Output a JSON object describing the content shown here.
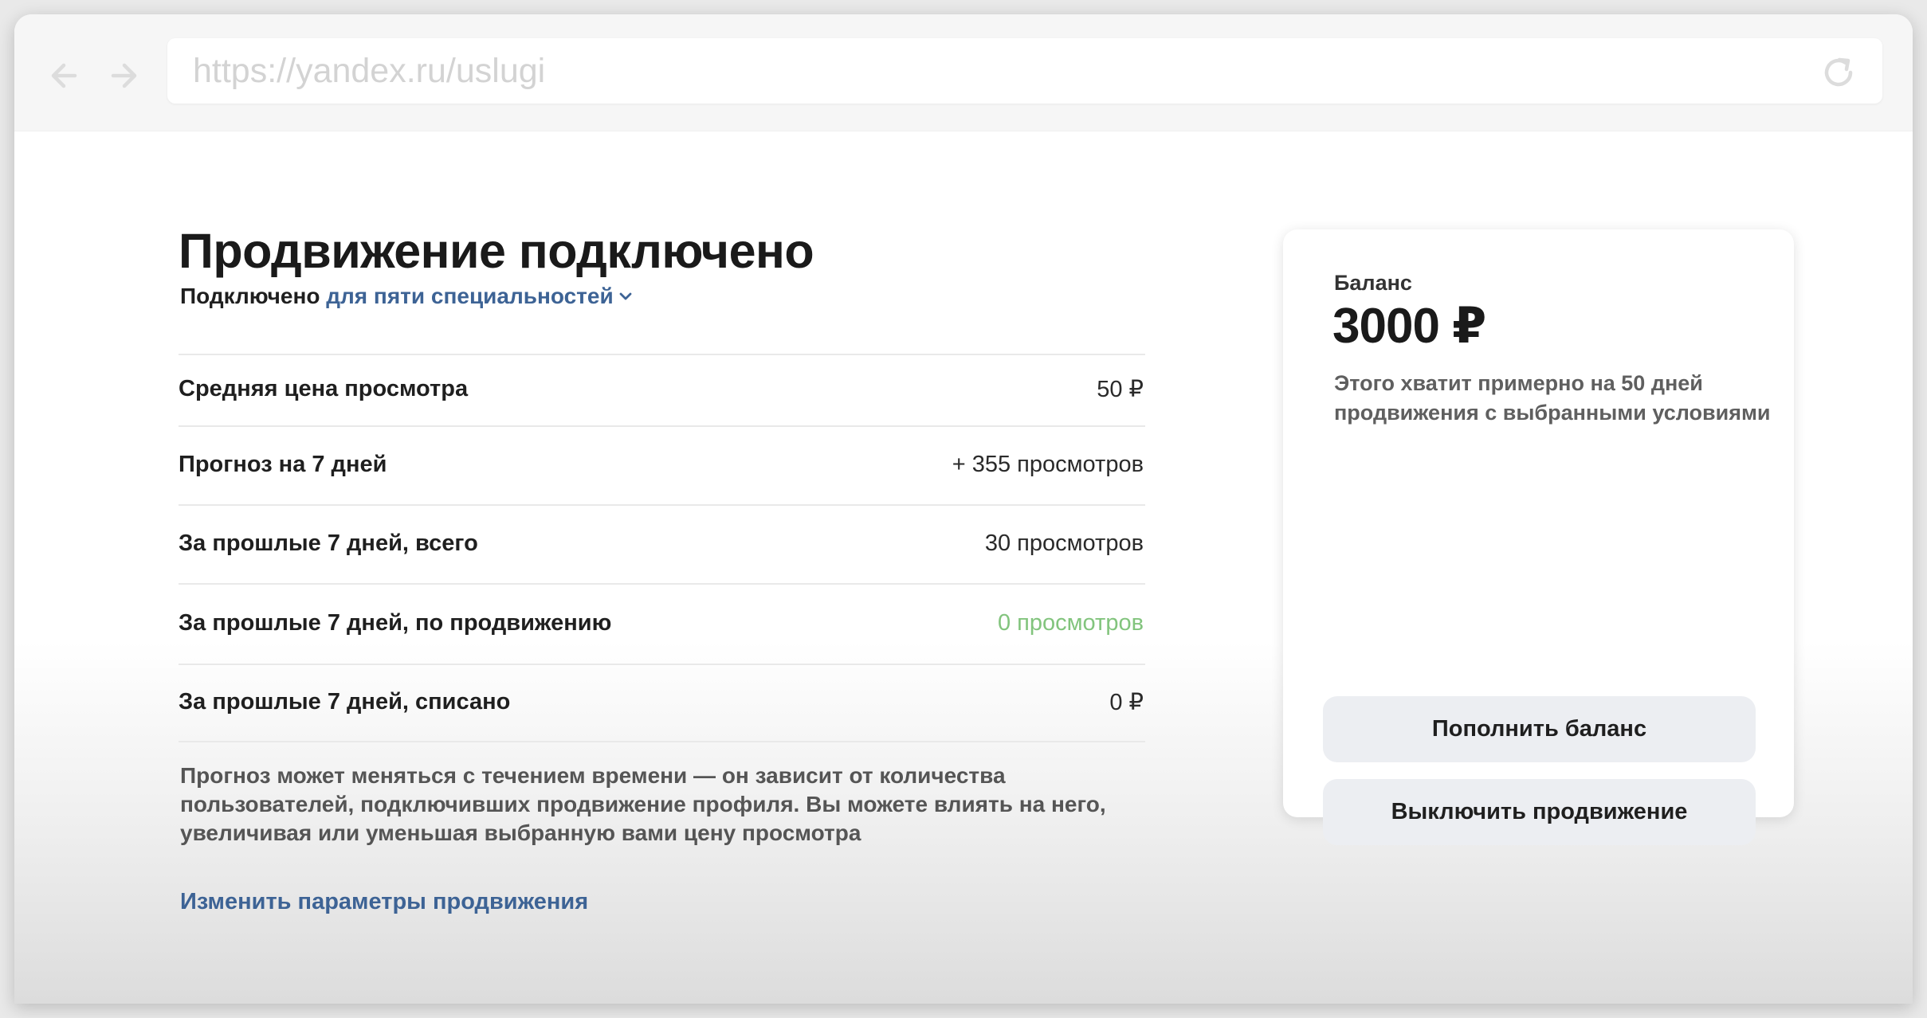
{
  "browser": {
    "url": "https://yandex.ru/uslugi",
    "back_icon": "arrow-left-icon",
    "forward_icon": "arrow-right-icon",
    "reload_icon": "reload-icon"
  },
  "main": {
    "title": "Продвижение подключено",
    "subtitle_prefix": "Подключено ",
    "subtitle_link": "для пяти специальностей",
    "stats": [
      {
        "label": "Средняя цена просмотра",
        "value": "50 ₽"
      },
      {
        "label": "Прогноз на 7 дней",
        "value": "+ 355 просмотров"
      },
      {
        "label": "За прошлые 7 дней, всего",
        "value": "30 просмотров"
      },
      {
        "label": "За прошлые 7 дней, по продвижению",
        "value": "0 просмотров"
      },
      {
        "label": "За прошлые 7 дней, списано",
        "value": "0 ₽"
      }
    ],
    "note": "Прогноз может меняться с течением времени — он зависит от количества пользователей, подключивших продвижение профиля. Вы можете влиять на него, увеличивая или уменьшая выбранную вами цену просмотра",
    "change_link": "Изменить параметры продвижения"
  },
  "balance_card": {
    "label": "Баланс",
    "amount": "3000 ₽",
    "description": "Этого хватит примерно на 50 дней продвижения с выбранными условиями",
    "topup_button": "Пополнить баланс",
    "disable_button": "Выключить продвижение"
  },
  "colors": {
    "link": "#3d6395",
    "positive": "#82c47d",
    "button_bg": "#eceef2"
  }
}
